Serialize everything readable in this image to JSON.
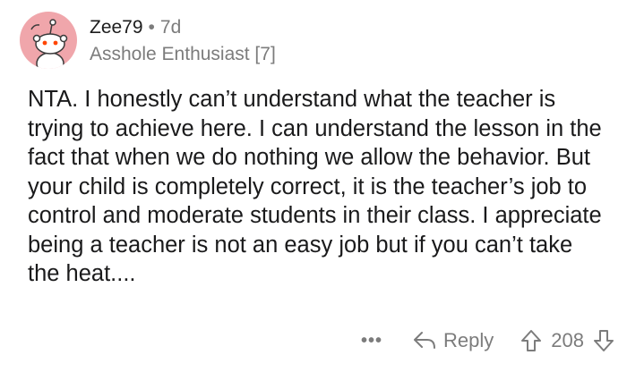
{
  "comment": {
    "author": "Zee79",
    "separator": "•",
    "age": "7d",
    "flair": "Asshole Enthusiast [7]",
    "body": "NTA. I honestly can’t understand what the teacher is trying to achieve here. I can understand the lesson in the fact that when we do nothing we allow the behavior. But your child is completely correct, it is the teacher’s job to control and moderate students in their class. I appreciate being a teacher is not an easy job but if you can’t take the heat....",
    "avatar_color": "#f0a6ab"
  },
  "actions": {
    "more_label": "•••",
    "reply_label": "Reply",
    "score": "208",
    "icons": {
      "reply": "reply-arrow-icon",
      "upvote": "upvote-arrow-icon",
      "downvote": "downvote-arrow-icon",
      "more": "more-options-icon"
    }
  }
}
